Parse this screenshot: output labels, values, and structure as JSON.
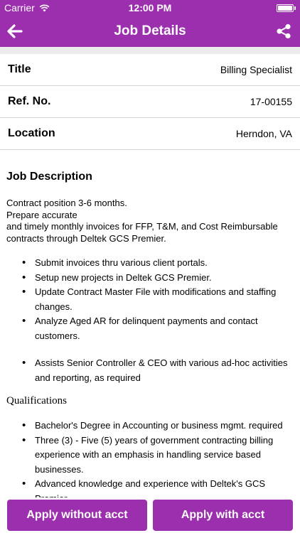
{
  "status_bar": {
    "carrier": "Carrier",
    "time": "12:00 PM",
    "battery_level": 1.0
  },
  "nav": {
    "title": "Job Details",
    "back_icon": "back-arrow-icon",
    "share_icon": "share-icon"
  },
  "details": [
    {
      "label": "Title",
      "value": "Billing Specialist"
    },
    {
      "label": "Ref. No.",
      "value": "17-00155"
    },
    {
      "label": "Location",
      "value": "Herndon, VA"
    }
  ],
  "description": {
    "heading": "Job Description",
    "intro": [
      "Contract position 3-6 months.",
      "Prepare accurate",
      "and timely monthly invoices for FFP, T&M, and Cost Reimbursable contracts through Deltek GCS Premier."
    ],
    "bullets": [
      "Submit invoices thru various client portals.",
      "Setup new projects in Deltek GCS Premier.",
      "Update Contract Master File with modifications and staffing changes.",
      "Analyze Aged AR for delinquent payments and contact customers."
    ],
    "bullets_2": [
      "Assists Senior Controller & CEO with various ad-hoc activities and reporting, as required"
    ]
  },
  "qualifications": {
    "heading": "Qualifications",
    "bullets": [
      "Bachelor's Degree in Accounting or business mgmt. required",
      "Three (3) - Five (5) years of government contracting billing experience with an emphasis in handling service based businesses.",
      "Advanced knowledge and experience with Deltek's GCS Premier"
    ]
  },
  "actions": {
    "apply_without": "Apply without acct",
    "apply_with": "Apply with acct"
  },
  "colors": {
    "brand": "#9b2fae"
  }
}
